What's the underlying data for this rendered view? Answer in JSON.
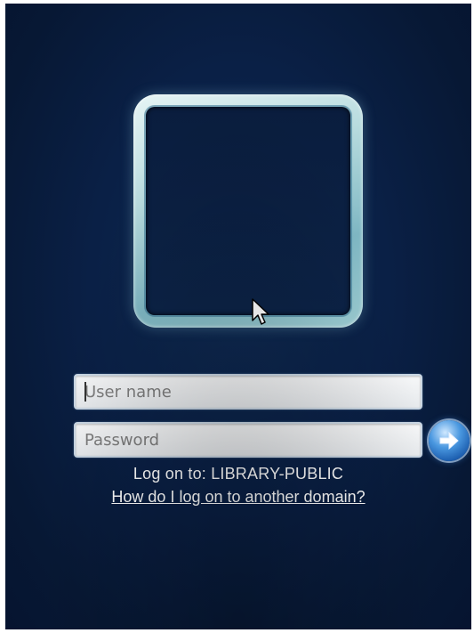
{
  "login": {
    "username_placeholder": "User name",
    "password_placeholder": "Password",
    "logon_to_text": "Log on to: LIBRARY-PUBLIC",
    "other_domain_link": "How do I log on to another domain?"
  },
  "icons": {
    "go_button": "arrow-right-icon",
    "user_tile": "user-picture-frame",
    "cursor": "mouse-pointer-icon"
  },
  "colors": {
    "background": "#0a2046",
    "go_button": "#2a6fc2",
    "text": "#ffffff"
  }
}
